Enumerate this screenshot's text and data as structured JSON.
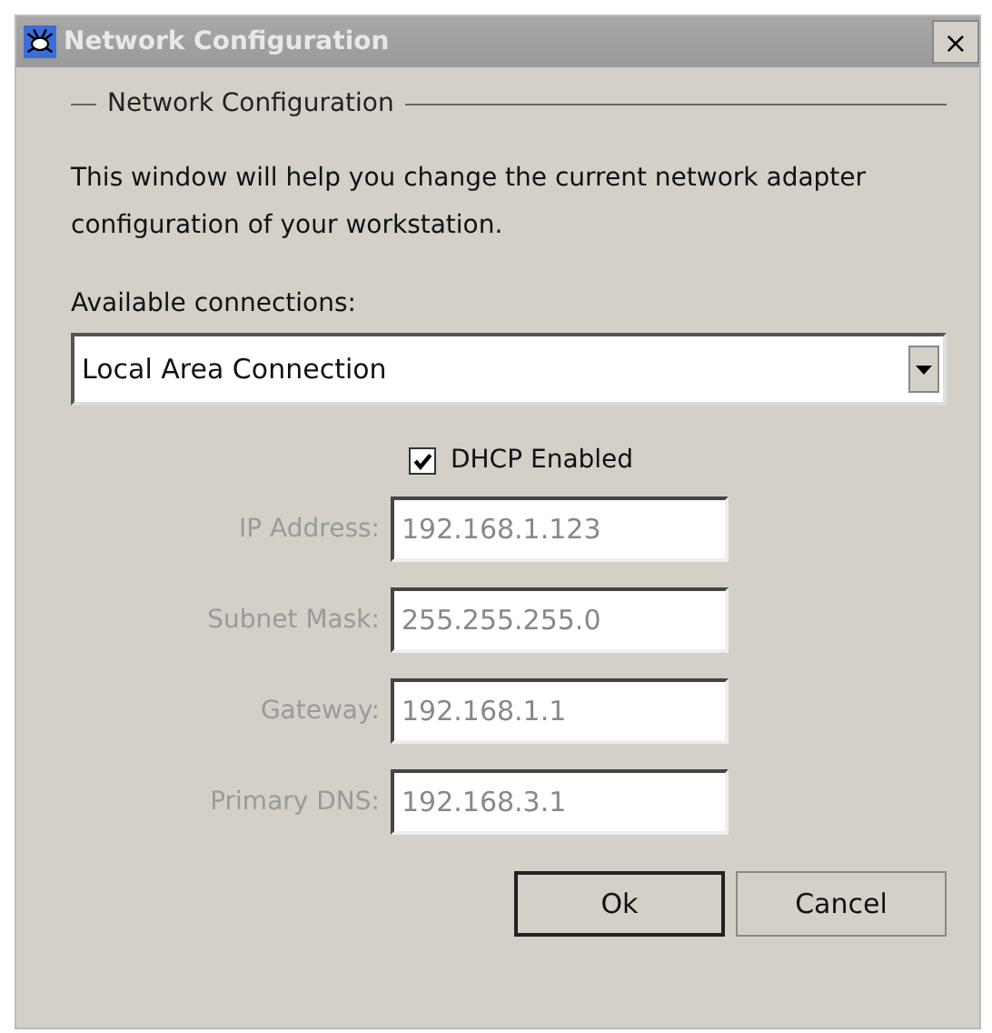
{
  "window": {
    "title": "Network Configuration",
    "close": "×"
  },
  "group": {
    "title": "Network Configuration"
  },
  "intro": "This window will help you change the current network adapter configuration of your workstation.",
  "connections": {
    "label": "Available connections:",
    "value": "Local Area Connection"
  },
  "dhcp": {
    "label": "DHCP Enabled",
    "checked": true
  },
  "fields": [
    {
      "label": "IP Address:",
      "value": "192.168.1.123",
      "disabled": true
    },
    {
      "label": "Subnet Mask:",
      "value": "255.255.255.0",
      "disabled": true
    },
    {
      "label": "Gateway:",
      "value": "192.168.1.1",
      "disabled": true
    },
    {
      "label": "Primary DNS:",
      "value": "192.168.3.1",
      "disabled": true
    }
  ],
  "buttons": [
    {
      "label": "Ok",
      "default": true
    },
    {
      "label": "Cancel",
      "default": false
    }
  ]
}
